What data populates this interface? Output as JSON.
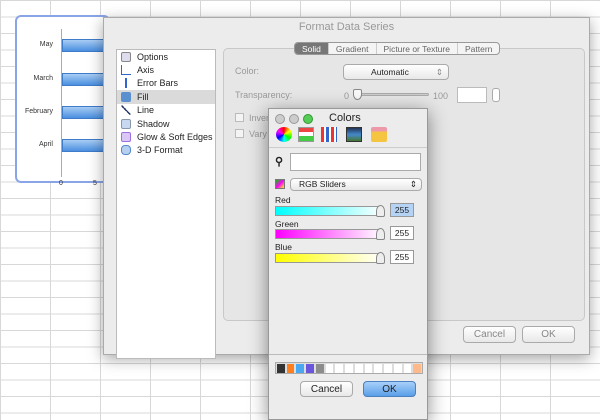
{
  "chart": {
    "categories": [
      "May",
      "March",
      "February",
      "April"
    ],
    "ticks": [
      "0",
      "5"
    ]
  },
  "format_dialog": {
    "title": "Format Data Series",
    "sidebar": [
      {
        "label": "Options",
        "icon": "options-icon"
      },
      {
        "label": "Axis",
        "icon": "axis-icon"
      },
      {
        "label": "Error Bars",
        "icon": "error-bars-icon"
      },
      {
        "label": "Fill",
        "icon": "fill-icon",
        "selected": true
      },
      {
        "label": "Line",
        "icon": "line-icon"
      },
      {
        "label": "Shadow",
        "icon": "shadow-icon"
      },
      {
        "label": "Glow & Soft Edges",
        "icon": "glow-icon"
      },
      {
        "label": "3-D Format",
        "icon": "3d-format-icon"
      }
    ],
    "tabs": [
      "Solid",
      "Gradient",
      "Picture or Texture",
      "Pattern"
    ],
    "color_label": "Color:",
    "color_value": "Automatic",
    "transparency_label": "Transparency:",
    "transparency_min": "0",
    "transparency_max": "100",
    "transparency_value": 0,
    "invert_label": "Inver",
    "vary_label": "Vary",
    "cancel": "Cancel",
    "ok": "OK"
  },
  "colors_panel": {
    "title": "Colors",
    "mode": "RGB Sliders",
    "search_value": "",
    "sliders": [
      {
        "label": "Red",
        "value": "255"
      },
      {
        "label": "Green",
        "value": "255"
      },
      {
        "label": "Blue",
        "value": "255"
      }
    ],
    "swatches": [
      "#333333",
      "#ff7f1f",
      "#4aa8f0",
      "#6a55dd",
      "#8c8c8c",
      "#ffffff",
      "#ffffff",
      "#ffffff",
      "#ffffff",
      "#ffffff",
      "#ffffff",
      "#ffffff",
      "#ffffff",
      "#ffffff",
      "#ffb98a"
    ],
    "cancel": "Cancel",
    "ok": "OK"
  }
}
